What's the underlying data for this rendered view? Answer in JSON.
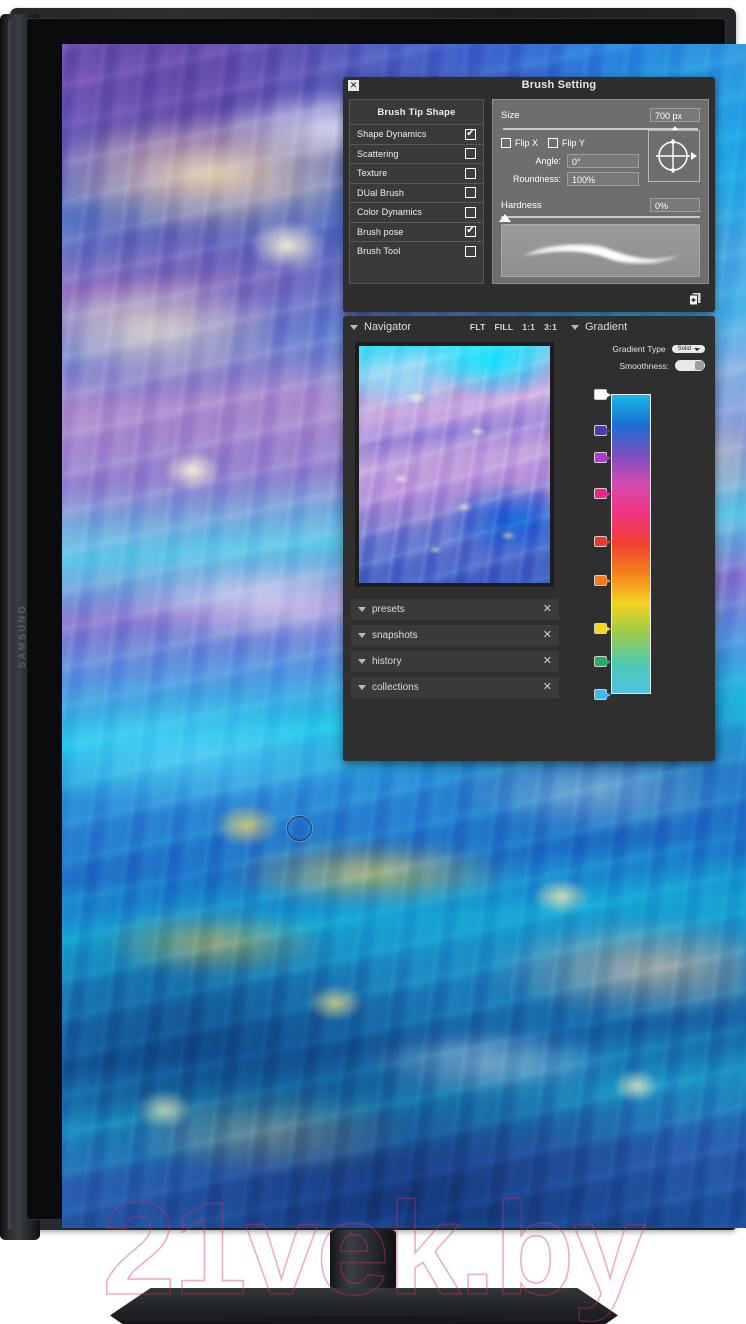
{
  "device": {
    "brand": "SAMSUNG",
    "watermark": "21vek.by"
  },
  "brush_setting": {
    "title": "Brush Setting",
    "close_label": "✕",
    "tip_shape_heading": "Brush Tip Shape",
    "tip_options": [
      {
        "label": "Shape Dynamics",
        "checked": true
      },
      {
        "label": "Scattering",
        "checked": false
      },
      {
        "label": "Texture",
        "checked": false
      },
      {
        "label": "DUal Brush",
        "checked": false
      },
      {
        "label": "Color Dynamics",
        "checked": false
      },
      {
        "label": "Brush pose",
        "checked": true
      },
      {
        "label": "Brush Tool",
        "checked": false
      }
    ],
    "size_label": "Size",
    "size_value": "700 px",
    "size_slider_percent": 88,
    "flip_x_label": "Flip X",
    "flip_y_label": "Flip Y",
    "flip_x_checked": false,
    "flip_y_checked": false,
    "angle_label": "Angle:",
    "angle_value": "0°",
    "roundness_label": "Roundness:",
    "roundness_value": "100%",
    "hardness_label": "Hardness",
    "hardness_value": "0%",
    "hardness_slider_percent": 2,
    "new_brush_icon": "new-brush-icon"
  },
  "navigator": {
    "title": "Navigator",
    "zoom_options": [
      "FLT",
      "FILL",
      "1:1",
      "3:1"
    ]
  },
  "dock_rows": [
    {
      "label": "presets",
      "close": "✕"
    },
    {
      "label": "snapshots",
      "close": "✕"
    },
    {
      "label": "history",
      "close": "✕"
    },
    {
      "label": "collections",
      "close": "✕"
    }
  ],
  "gradient": {
    "title": "Gradient",
    "type_label": "Gradient Type",
    "type_value": "Solid",
    "smoothness_label": "Smoothness:",
    "stops": [
      {
        "color": "#ffffff",
        "pos": 0
      },
      {
        "color": "#4a3fa8",
        "pos": 12
      },
      {
        "color": "#b03ad0",
        "pos": 21
      },
      {
        "color": "#f0218a",
        "pos": 33
      },
      {
        "color": "#f03a2a",
        "pos": 49
      },
      {
        "color": "#f47b1e",
        "pos": 62
      },
      {
        "color": "#f2d821",
        "pos": 78
      },
      {
        "color": "#1fb36a",
        "pos": 89
      },
      {
        "color": "#44b8ef",
        "pos": 100
      }
    ],
    "ramp_colors": [
      "#19b8ea",
      "#1a6fd0",
      "#7a4fc0",
      "#d44bb0",
      "#f2337f",
      "#f1402f",
      "#f5841c",
      "#f3d422",
      "#9ccb4a",
      "#4fc9b0",
      "#4ec3e6"
    ]
  },
  "colors": {
    "panel_bg": "#2e2e2e",
    "panel_bg_alt": "#3a3a3a",
    "field_bg": "#6e6e6e",
    "text": "#dcdcdc",
    "bezel": "#0a0b0c",
    "watermark": "#d62e60"
  }
}
